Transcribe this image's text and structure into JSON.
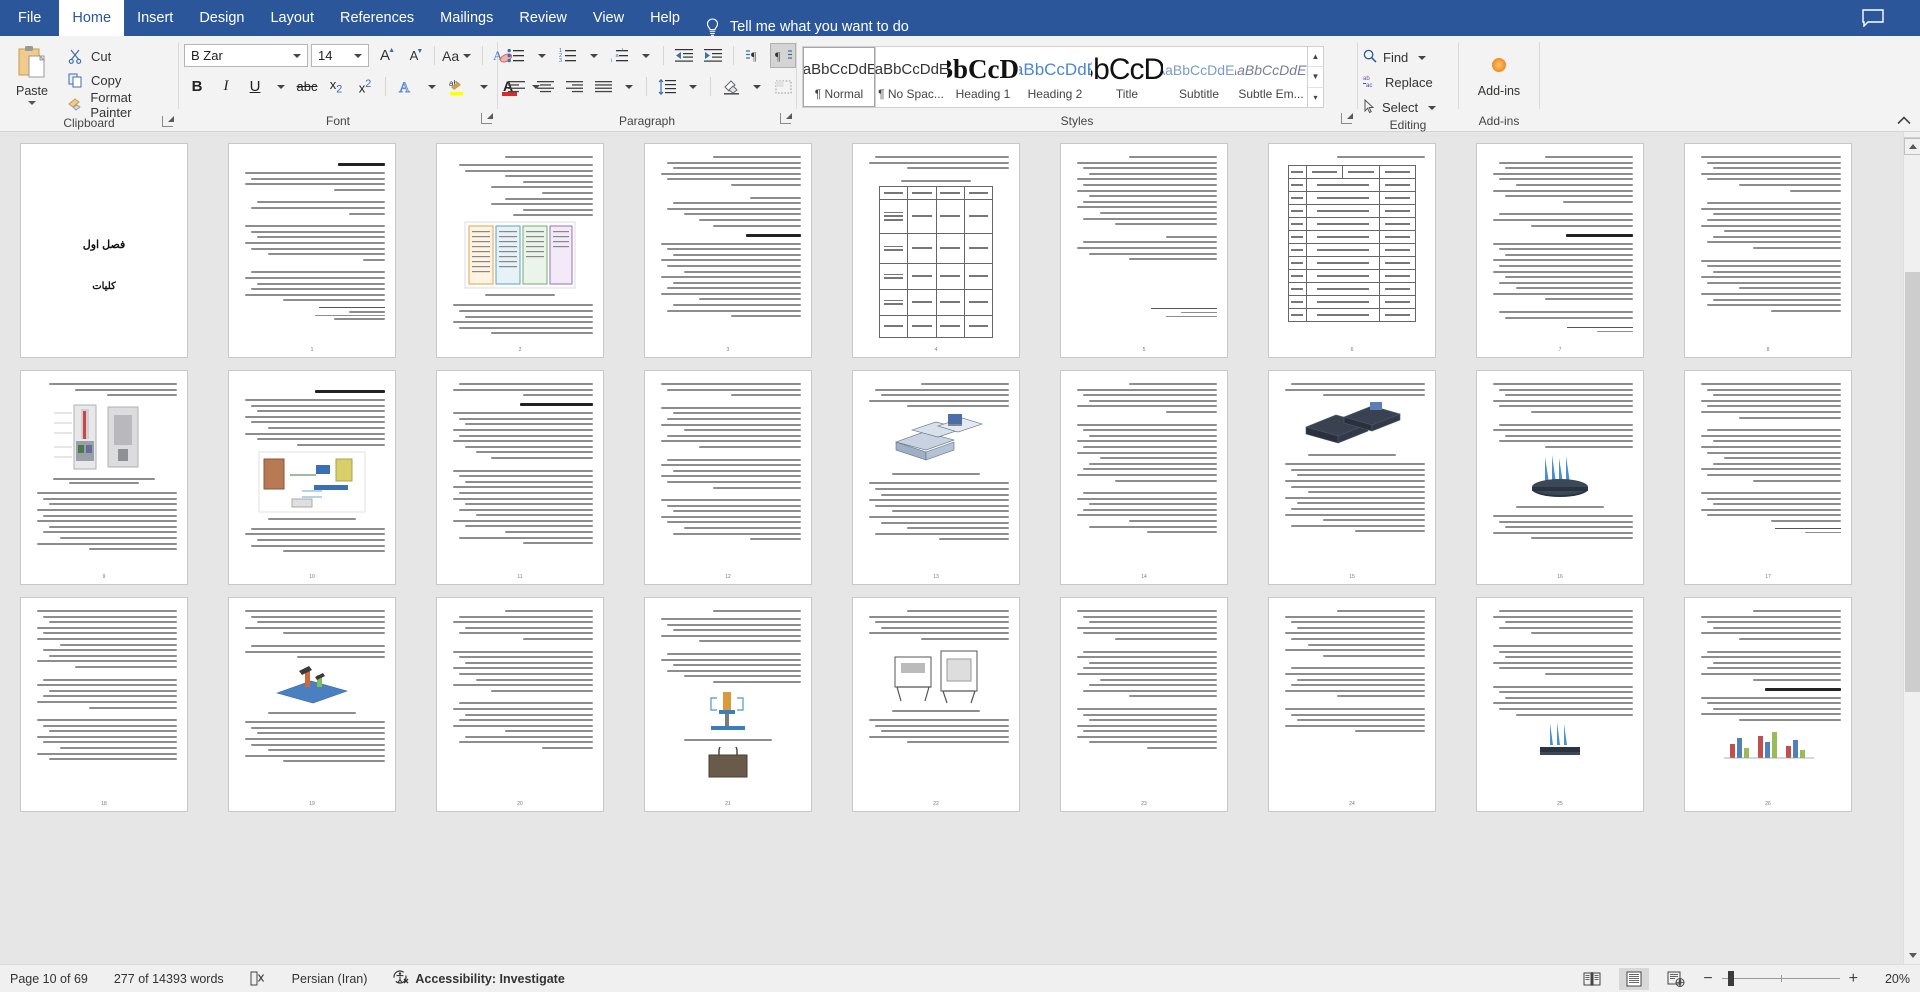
{
  "app": {
    "ribbon_tabs": [
      {
        "label": "File",
        "id": "file"
      },
      {
        "label": "Home",
        "id": "home",
        "active": true
      },
      {
        "label": "Insert",
        "id": "insert"
      },
      {
        "label": "Design",
        "id": "design"
      },
      {
        "label": "Layout",
        "id": "layout"
      },
      {
        "label": "References",
        "id": "references"
      },
      {
        "label": "Mailings",
        "id": "mailings"
      },
      {
        "label": "Review",
        "id": "review"
      },
      {
        "label": "View",
        "id": "view"
      },
      {
        "label": "Help",
        "id": "help"
      }
    ],
    "tell_me": "Tell me what you want to do",
    "comments_icon": "comment-icon"
  },
  "ribbon": {
    "clipboard": {
      "group_label": "Clipboard",
      "paste": "Paste",
      "cut": "Cut",
      "copy": "Copy",
      "format_painter": "Format Painter",
      "icons": [
        "scissors-icon",
        "copy-icon",
        "paintbrush-icon"
      ]
    },
    "font": {
      "group_label": "Font",
      "font_name": "B Zar",
      "font_size": "14",
      "grow_font": "A",
      "shrink_font": "A",
      "change_case": "Aa",
      "clear_formatting": "clear-formatting-icon",
      "bold": "B",
      "italic": "I",
      "underline": "U",
      "strikethrough": "abc",
      "subscript": "x₂",
      "superscript": "x²",
      "text_effects": "A",
      "highlight": "ab",
      "font_color": "A"
    },
    "paragraph": {
      "group_label": "Paragraph",
      "bullets": "bullets-icon",
      "numbering": "numbering-icon",
      "multilevel": "multilevel-list-icon",
      "decrease_indent": "decrease-indent-icon",
      "increase_indent": "increase-indent-icon",
      "ltr": "left-to-right-icon",
      "rtl": "right-to-left-icon",
      "sort": "sort-icon",
      "show_marks": "¶",
      "align_left": "align-left-icon",
      "align_center": "align-center-icon",
      "align_right": "align-right-icon",
      "justify": "justify-icon",
      "line_spacing": "line-spacing-icon",
      "shading": "shading-icon",
      "borders": "borders-icon"
    },
    "styles": {
      "group_label": "Styles",
      "items": [
        {
          "preview": "AaBbCcDdEe",
          "name": "¶ Normal",
          "selected": true
        },
        {
          "preview": "AaBbCcDdEe",
          "name": "¶ No Spac...",
          "selected": false
        },
        {
          "preview": "AaBbCcDdEe",
          "name": "Heading 1",
          "selected": false
        },
        {
          "preview": "AaBbCcDdEe",
          "name": "Heading 2",
          "selected": false
        },
        {
          "preview": "AaBbCcDdEe",
          "name": "Title",
          "selected": false
        },
        {
          "preview": "AaBbCcDdEe",
          "name": "Subtitle",
          "selected": false
        },
        {
          "preview": "AaBbCcDdEe",
          "name": "Subtle Em...",
          "selected": false
        }
      ]
    },
    "editing": {
      "group_label": "Editing",
      "find": "Find",
      "replace": "Replace",
      "select": "Select"
    },
    "addins": {
      "group_label": "Add-ins",
      "button": "Add-ins"
    },
    "collapse_icon": "chevron-up-icon"
  },
  "status": {
    "page": "Page 10 of 69",
    "words": "277 of 14393 words",
    "proofing_icon": "proofing-errors-icon",
    "language": "Persian (Iran)",
    "accessibility": "Accessibility: Investigate",
    "view_read": "read-mode-icon",
    "view_print": "print-layout-icon",
    "view_web": "web-layout-icon",
    "zoom_out": "−",
    "zoom_in": "+",
    "zoom_level": "20%",
    "zoom_value": 20
  },
  "document": {
    "cover": {
      "title": "فصل اول",
      "subtitle": "کلیات"
    },
    "rows": [
      {
        "pages": [
          {
            "num": "",
            "kind": "cover"
          },
          {
            "num": "1",
            "kind": "text"
          },
          {
            "num": "2",
            "kind": "figure-flow"
          },
          {
            "num": "3",
            "kind": "text-head"
          },
          {
            "num": "4",
            "kind": "table"
          },
          {
            "num": "5",
            "kind": "text"
          },
          {
            "num": "6",
            "kind": "table-spec"
          },
          {
            "num": "7",
            "kind": "text"
          },
          {
            "num": "8",
            "kind": "text"
          }
        ]
      },
      {
        "pages": [
          {
            "num": "9",
            "kind": "figure-photo"
          },
          {
            "num": "10",
            "kind": "figure-diagram"
          },
          {
            "num": "11",
            "kind": "text"
          },
          {
            "num": "12",
            "kind": "text"
          },
          {
            "num": "13",
            "kind": "figure-3d"
          },
          {
            "num": "14",
            "kind": "text"
          },
          {
            "num": "15",
            "kind": "figure-iso"
          },
          {
            "num": "16",
            "kind": "figure-nozzle"
          },
          {
            "num": "17",
            "kind": "text"
          }
        ]
      },
      {
        "pages": [
          {
            "num": "18",
            "kind": "text"
          },
          {
            "num": "19",
            "kind": "figure-printer"
          },
          {
            "num": "20",
            "kind": "text"
          },
          {
            "num": "21",
            "kind": "figure-bag"
          },
          {
            "num": "22",
            "kind": "figure-machine"
          },
          {
            "num": "23",
            "kind": "text"
          },
          {
            "num": "24",
            "kind": "text"
          },
          {
            "num": "25",
            "kind": "figure-tool"
          },
          {
            "num": "26",
            "kind": "figure-chart"
          }
        ]
      }
    ]
  },
  "colors": {
    "accent": "#2b579a",
    "ribbon_bg": "#f3f3f3",
    "doc_bg": "#e6e6e6",
    "highlight_yellow": "#ffff00",
    "font_red": "#d92b2b",
    "addin_orange": "#f2a03d"
  }
}
